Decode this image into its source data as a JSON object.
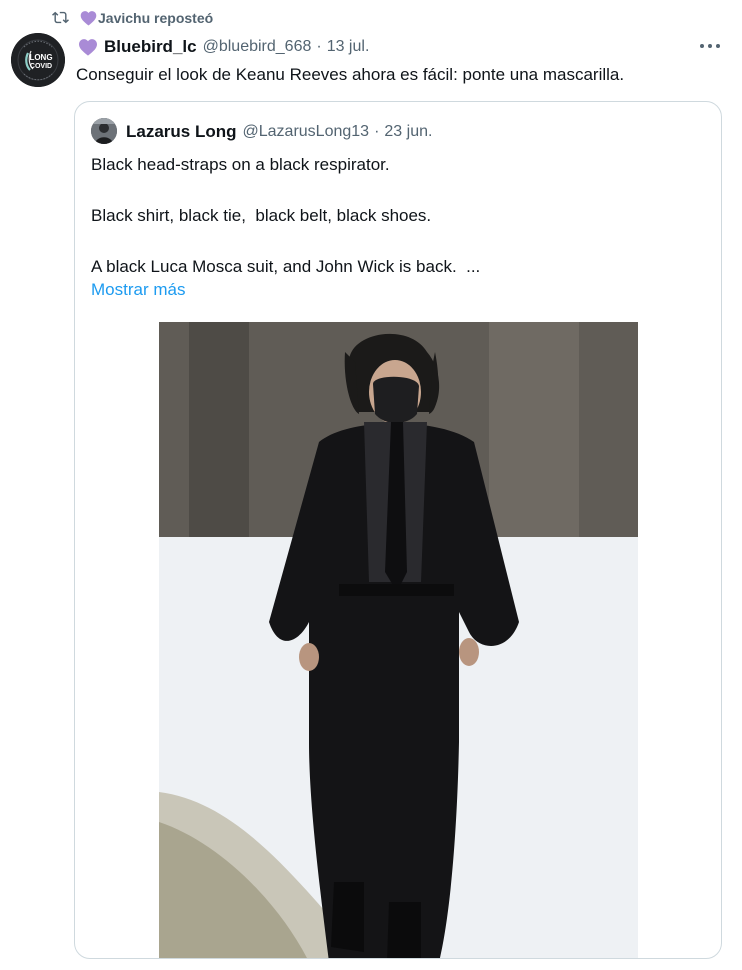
{
  "retweet": {
    "icon": "retweet-icon",
    "heart_icon": "purple-heart-icon",
    "text": "Javichu reposteó"
  },
  "tweet": {
    "author_name": "Bluebird_lc",
    "author_handle": "@bluebird_668",
    "separator": "·",
    "time": "13 jul.",
    "text": "Conseguir el look de Keanu Reeves ahora es fácil: ponte una mascarilla.",
    "avatar_badge": {
      "line1": "LONG",
      "line2": "COVID"
    }
  },
  "quoted": {
    "author_name": "Lazarus Long",
    "author_handle": "@LazarusLong13",
    "separator": "·",
    "time": "23 jun.",
    "lines": [
      "Black head-straps on a black respirator.",
      "Black shirt, black tie,  black belt, black shoes.",
      "A black Luca Mosca suit, and John Wick is back.  ..."
    ],
    "show_more": "Mostrar más"
  },
  "colors": {
    "accent": "#1d9bf0",
    "secondary_text": "#536471",
    "heart": "#a98bd6",
    "border": "#cfd9de"
  }
}
